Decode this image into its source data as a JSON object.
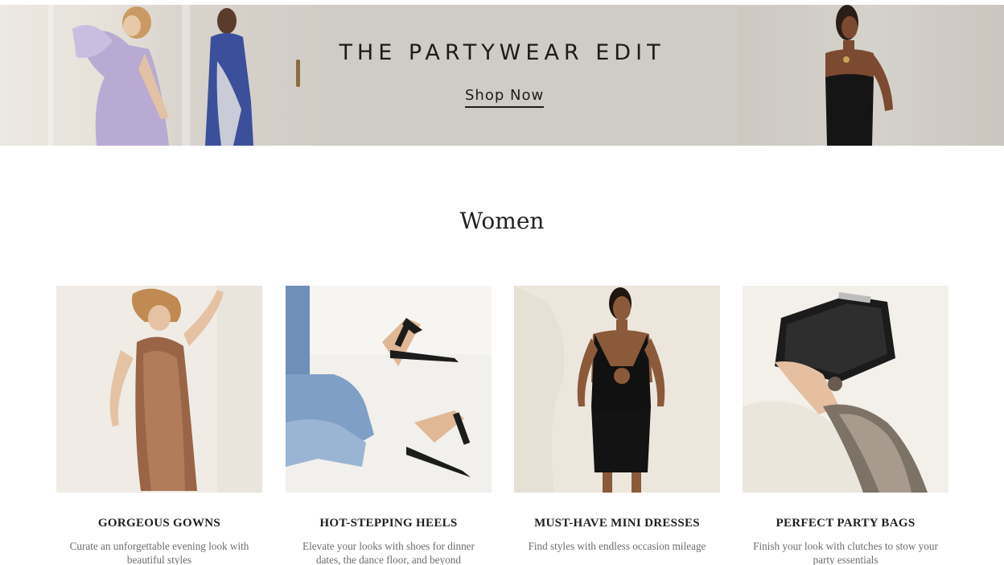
{
  "hero": {
    "title": "THE PARTYWEAR EDIT",
    "cta_label": "Shop Now"
  },
  "section": {
    "title": "Women"
  },
  "cards": [
    {
      "title": "GORGEOUS GOWNS",
      "description": "Curate an unforgettable evening look with beautiful styles",
      "image": "woman-in-sequin-gown"
    },
    {
      "title": "HOT-STEPPING HEELS",
      "description": "Elevate your looks with shoes for dinner dates, the dance floor, and beyond",
      "image": "black-strappy-heels-and-jeans"
    },
    {
      "title": "MUST-HAVE MINI DRESSES",
      "description": "Find styles with endless occasion mileage",
      "image": "woman-in-black-mini-dress"
    },
    {
      "title": "PERFECT PARTY BAGS",
      "description": "Finish your look with clutches to stow your party essentials",
      "image": "black-box-clutch-in-hand"
    }
  ],
  "colors": {
    "hero_bg": "#cfcbc5",
    "text": "#1c1c1c",
    "muted_text": "#6d6d6d",
    "card_bg": "#f1ede6"
  }
}
